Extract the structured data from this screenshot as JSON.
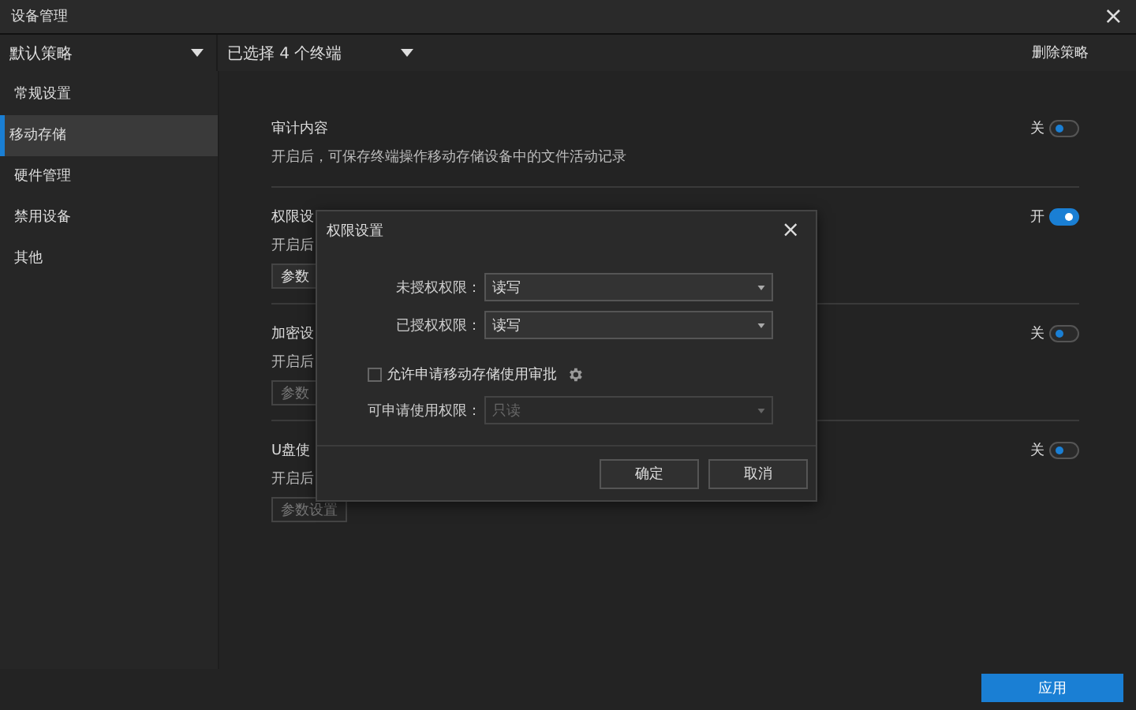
{
  "window": {
    "title": "设备管理",
    "close": "×"
  },
  "toolbar": {
    "policy": "默认策略",
    "terminals": "已选择 4 个终端",
    "delete": "删除策略"
  },
  "sidebar": {
    "items": [
      {
        "label": "常规设置",
        "selected": false
      },
      {
        "label": "移动存储",
        "selected": true
      },
      {
        "label": "硬件管理",
        "selected": false
      },
      {
        "label": "禁用设备",
        "selected": false
      },
      {
        "label": "其他",
        "selected": false
      }
    ]
  },
  "sections": [
    {
      "title": "审计内容",
      "description": "开启后，可保存终端操作移动存储设备中的文件活动记录",
      "state_label": "关",
      "on": false
    },
    {
      "title": "权限设",
      "description": "开启后",
      "button": "参数",
      "button_disabled": false,
      "state_label": "开",
      "on": true
    },
    {
      "title": "加密设",
      "description": "开启后",
      "button": "参数",
      "button_disabled": true,
      "state_label": "关",
      "on": false
    },
    {
      "title": "U盘使",
      "description": "开启后",
      "button": "参数设置",
      "button_disabled": true,
      "state_label": "关",
      "on": false
    }
  ],
  "dialog": {
    "title": "权限设置",
    "close": "×",
    "fields": [
      {
        "label": "未授权权限：",
        "value": "读写",
        "disabled": false
      },
      {
        "label": "已授权权限：",
        "value": "读写",
        "disabled": false
      }
    ],
    "checkbox": {
      "label": "允许申请移动存储使用审批",
      "checked": false
    },
    "request_field": {
      "label": "可申请使用权限：",
      "value": "只读",
      "disabled": true
    },
    "buttons": [
      "确定",
      "取消"
    ]
  },
  "apply": "应用"
}
